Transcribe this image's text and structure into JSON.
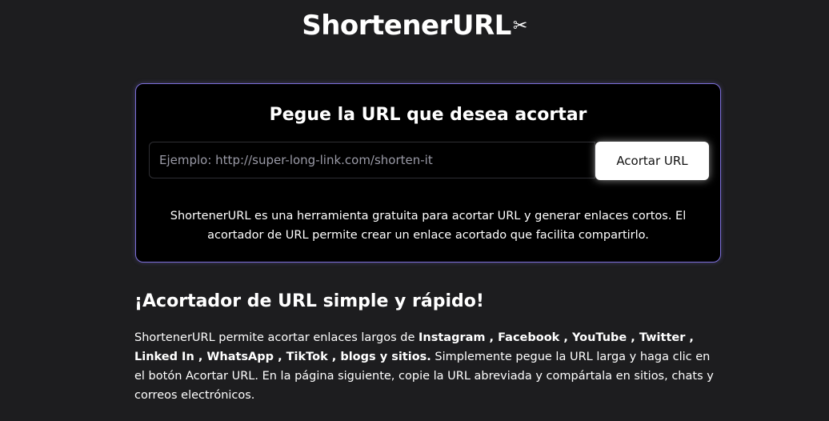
{
  "header": {
    "logo_text": "ShortenerURL",
    "logo_icon": "✂"
  },
  "shortener": {
    "title": "Pegue la URL que desea acortar",
    "input_placeholder": "Ejemplo: http://super-long-link.com/shorten-it",
    "input_value": "",
    "button_label": "Acortar URL",
    "description": "ShortenerURL es una herramienta gratuita para acortar URL y generar enlaces cortos. El acortador de URL permite crear un enlace acortado que facilita compartirlo."
  },
  "about": {
    "title": "¡Acortador de URL simple y rápido!",
    "intro": "ShortenerURL permite acortar enlaces largos de ",
    "platforms": [
      "Instagram",
      "Facebook",
      "YouTube",
      "Twitter",
      "Linked In",
      "WhatsApp",
      "TikTok"
    ],
    "platforms_tail": "blogs y sitios.",
    "rest": " Simplemente pegue la URL larga y haga clic en el botón Acortar URL. En la página siguiente, copie la URL abreviada y compártala en sitios, chats y correos electrónicos."
  },
  "colors": {
    "background": "#1d1d1f",
    "card_background": "#000000",
    "card_border": "#7c6fd9",
    "button_background": "#ffffff",
    "text": "#ffffff",
    "placeholder": "#9a9aa6"
  }
}
